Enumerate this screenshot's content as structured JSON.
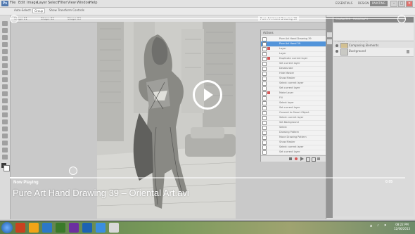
{
  "photoshop": {
    "logo": "Ps",
    "menus": [
      "File",
      "Edit",
      "Image",
      "Layer",
      "Select",
      "Filter",
      "View",
      "Window",
      "Help"
    ],
    "workspaces": [
      "ESSENTIALS",
      "DESIGN",
      "PAINTING"
    ],
    "window_controls": [
      "–",
      "□",
      "×"
    ],
    "options_bar": [
      "Auto-Select:",
      "Group",
      "Show Transform Controls"
    ],
    "doc_tabs": [
      "Pure Art Hand Drawing 39",
      "Shape 01",
      "Shape 02",
      "Shape 03"
    ],
    "actions_panel": {
      "title": "Actions",
      "rows": [
        {
          "label": "Pure Art Hand Drawing 39",
          "sel": false,
          "red": false
        },
        {
          "label": "Pure Art Hand 39",
          "sel": true,
          "red": false
        },
        {
          "label": "Layer",
          "sel": false,
          "red": true
        },
        {
          "label": "Layer",
          "sel": false,
          "red": false
        },
        {
          "label": "Duplicate current layer",
          "sel": false,
          "red": true
        },
        {
          "label": "Set current layer",
          "sel": false,
          "red": false
        },
        {
          "label": "Desaturate",
          "sel": false,
          "red": false
        },
        {
          "label": "Hide Master",
          "sel": false,
          "red": false
        },
        {
          "label": "Show Master",
          "sel": false,
          "red": false
        },
        {
          "label": "Select current layer",
          "sel": false,
          "red": false
        },
        {
          "label": "Set current layer",
          "sel": false,
          "red": false
        },
        {
          "label": "Make Layer",
          "sel": false,
          "red": true
        },
        {
          "label": "Fill",
          "sel": false,
          "red": false
        },
        {
          "label": "Select layer",
          "sel": false,
          "red": false
        },
        {
          "label": "Set current layer",
          "sel": false,
          "red": false
        },
        {
          "label": "Convert to Smart Object",
          "sel": false,
          "red": false
        },
        {
          "label": "Select current layer",
          "sel": false,
          "red": false
        },
        {
          "label": "Set Background",
          "sel": false,
          "red": false
        },
        {
          "label": "Select",
          "sel": false,
          "red": false
        },
        {
          "label": "Drawing Pattern",
          "sel": false,
          "red": false
        },
        {
          "label": "Move Drawing Pattern",
          "sel": false,
          "red": false
        },
        {
          "label": "Show Master",
          "sel": false,
          "red": false
        },
        {
          "label": "Select current layer",
          "sel": false,
          "red": false
        },
        {
          "label": "Set current layer",
          "sel": false,
          "red": false
        }
      ]
    },
    "panel_tabs": [
      "CHARACTER",
      "PARAGRAPH"
    ],
    "layers_tabs": [
      "LAYERS",
      "CHANNELS",
      "PATHS"
    ],
    "layers": [
      "Composing Elements",
      "Background"
    ]
  },
  "player": {
    "now_playing_label": "Now Playing",
    "title": "Pure Art Hand Drawing 39 – Oriental Art.avi",
    "elapsed": "0:05",
    "progress": 0.16
  },
  "taskbar": {
    "icons": [
      {
        "color": "#c9411f"
      },
      {
        "color": "#f2a417"
      },
      {
        "color": "#2c78c8"
      },
      {
        "color": "#3a7a2a"
      },
      {
        "color": "#6c2fa0"
      },
      {
        "color": "#1d62b3"
      },
      {
        "color": "#3b8ee0"
      },
      {
        "color": "#d8d8d8"
      }
    ],
    "clock_time": "08:22 PM",
    "clock_date": "12/06/2013"
  }
}
